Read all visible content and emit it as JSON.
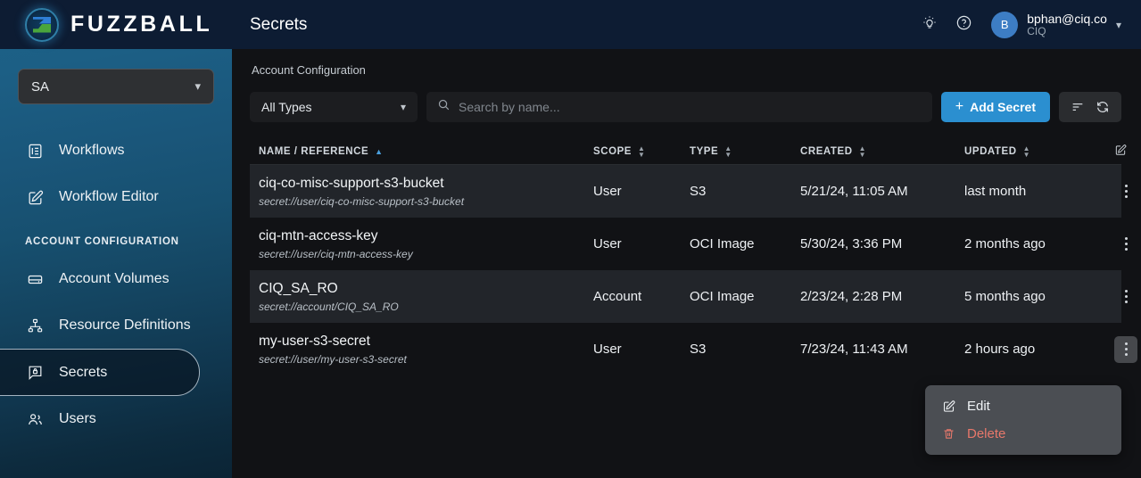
{
  "brand": {
    "name": "FUZZBALL",
    "logo_icon": "fuzzball-logo-icon"
  },
  "sidebar": {
    "account_selector": {
      "value": "SA",
      "chevron": "chevron-down-icon"
    },
    "items": [
      {
        "label": "Workflows",
        "icon": "list-document-icon",
        "active": false
      },
      {
        "label": "Workflow Editor",
        "icon": "pencil-square-icon",
        "active": false
      }
    ],
    "section_label": "ACCOUNT CONFIGURATION",
    "config_items": [
      {
        "label": "Account Volumes",
        "icon": "drive-icon",
        "active": false
      },
      {
        "label": "Resource Definitions",
        "icon": "hierarchy-icon",
        "active": false
      },
      {
        "label": "Secrets",
        "icon": "secret-lock-icon",
        "active": true
      },
      {
        "label": "Users",
        "icon": "users-icon",
        "active": false
      }
    ]
  },
  "header": {
    "title": "Secrets",
    "theme_icon": "lightbulb-icon",
    "help_icon": "question-circle-icon",
    "avatar_initial": "B",
    "user_email": "bphan@ciq.co",
    "user_org": "CIQ",
    "user_chevron": "chevron-down-icon"
  },
  "breadcrumb": "Account Configuration",
  "toolbar": {
    "type_filter": {
      "value": "All Types",
      "chevron": "chevron-down-icon"
    },
    "search": {
      "placeholder": "Search by name...",
      "value": "",
      "icon": "search-icon"
    },
    "add_button": {
      "label": "Add Secret",
      "plus": "+",
      "color": "#2b8fd0"
    },
    "density_icon": "sort-lines-icon",
    "refresh_icon": "refresh-icon"
  },
  "table": {
    "columns": [
      {
        "label": "NAME / REFERENCE",
        "sort": "asc"
      },
      {
        "label": "SCOPE",
        "sort": "none"
      },
      {
        "label": "TYPE",
        "sort": "none"
      },
      {
        "label": "CREATED",
        "sort": "none"
      },
      {
        "label": "UPDATED",
        "sort": "none"
      }
    ],
    "edit_column_icon": "pencil-square-icon",
    "rows": [
      {
        "name": "ciq-co-misc-support-s3-bucket",
        "reference": "secret://user/ciq-co-misc-support-s3-bucket",
        "scope": "User",
        "type": "S3",
        "created": "5/21/24, 11:05 AM",
        "updated": "last month"
      },
      {
        "name": "ciq-mtn-access-key",
        "reference": "secret://user/ciq-mtn-access-key",
        "scope": "User",
        "type": "OCI Image",
        "created": "5/30/24, 3:36 PM",
        "updated": "2 months ago"
      },
      {
        "name": "CIQ_SA_RO",
        "reference": "secret://account/CIQ_SA_RO",
        "scope": "Account",
        "type": "OCI Image",
        "created": "2/23/24, 2:28 PM",
        "updated": "5 months ago"
      },
      {
        "name": "my-user-s3-secret",
        "reference": "secret://user/my-user-s3-secret",
        "scope": "User",
        "type": "S3",
        "created": "7/23/24, 11:43 AM",
        "updated": "2 hours ago"
      }
    ]
  },
  "context_menu": {
    "open_for_row": 3,
    "items": [
      {
        "label": "Edit",
        "icon": "pencil-square-icon",
        "danger": false
      },
      {
        "label": "Delete",
        "icon": "trash-icon",
        "danger": true
      }
    ]
  }
}
